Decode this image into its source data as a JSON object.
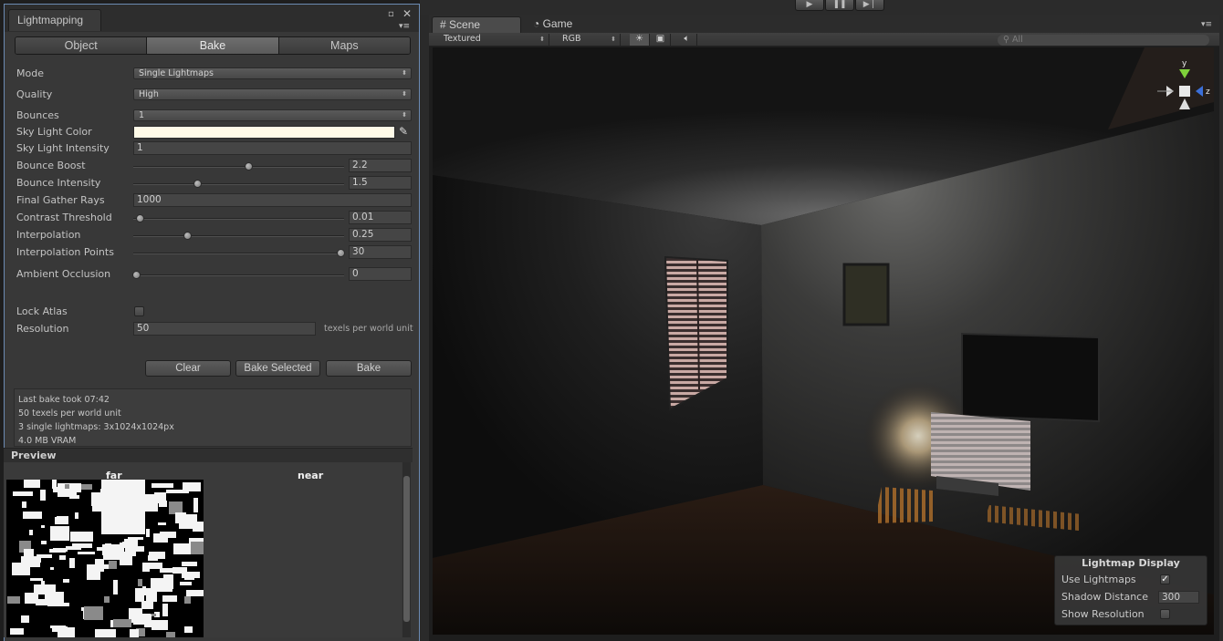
{
  "toolbar": {
    "play_icon": "play-icon",
    "pause_icon": "pause-icon",
    "step_icon": "step-icon"
  },
  "lightmapping": {
    "window_title": "Lightmapping",
    "tabs": [
      "Object",
      "Bake",
      "Maps"
    ],
    "active_tab": "Bake",
    "mode_label": "Mode",
    "mode_value": "Single Lightmaps",
    "quality_label": "Quality",
    "quality_value": "High",
    "bounces_label": "Bounces",
    "bounces_value": "1",
    "sky_light_color_label": "Sky Light Color",
    "sky_light_color": "#fffbe8",
    "sky_light_intensity_label": "Sky Light Intensity",
    "sky_light_intensity_value": "1",
    "bounce_boost_label": "Bounce Boost",
    "bounce_boost_value": "2.2",
    "bounce_intensity_label": "Bounce Intensity",
    "bounce_intensity_value": "1.5",
    "final_gather_rays_label": "Final Gather Rays",
    "final_gather_rays_value": "1000",
    "contrast_threshold_label": "Contrast Threshold",
    "contrast_threshold_value": "0.01",
    "interpolation_label": "Interpolation",
    "interpolation_value": "0.25",
    "interpolation_points_label": "Interpolation Points",
    "interpolation_points_value": "30",
    "ambient_occlusion_label": "Ambient Occlusion",
    "ambient_occlusion_value": "0",
    "lock_atlas_label": "Lock Atlas",
    "lock_atlas_checked": false,
    "resolution_label": "Resolution",
    "resolution_value": "50",
    "resolution_unit": "texels per world unit",
    "clear_button": "Clear",
    "bake_selected_button": "Bake Selected",
    "bake_button": "Bake",
    "info_lines": [
      "Last bake took 07:42",
      "50 texels per world unit",
      "3 single lightmaps: 3x1024x1024px",
      "4.0 MB VRAM"
    ],
    "preview_title": "Preview",
    "preview_far_label": "far",
    "preview_near_label": "near"
  },
  "scene": {
    "tab_scene": "Scene",
    "tab_game": "Game",
    "render_mode": "Textured",
    "color_mode": "RGB",
    "search_placeholder": "All",
    "gizmo_y": "y",
    "gizmo_z": "z"
  },
  "lightmap_display": {
    "title": "Lightmap Display",
    "use_lightmaps_label": "Use Lightmaps",
    "use_lightmaps_checked": true,
    "shadow_distance_label": "Shadow Distance",
    "shadow_distance_value": "300",
    "show_resolution_label": "Show Resolution",
    "show_resolution_checked": false
  },
  "colors": {
    "window_border": "#6c8bb3",
    "panel_bg": "#383838",
    "gizmo_y": "#7fd13a",
    "gizmo_z": "#3b6fd8"
  }
}
